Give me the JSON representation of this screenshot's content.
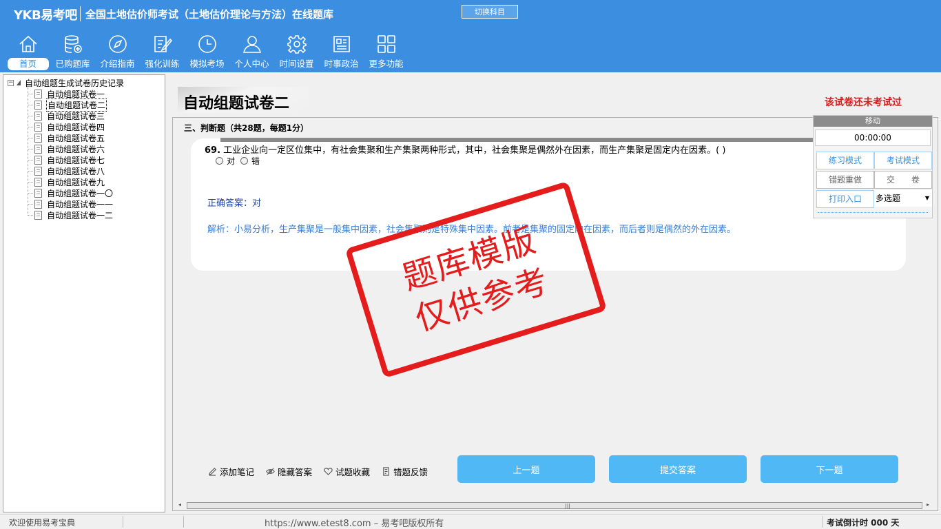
{
  "header": {
    "logo": "YKB易考吧",
    "title": "全国土地估价师考试（土地估价理论与方法）在线题库",
    "switch_subject": "切换科目",
    "nav": [
      {
        "label": "首页",
        "icon": "home-icon"
      },
      {
        "label": "已购题库",
        "icon": "database-icon"
      },
      {
        "label": "介绍指南",
        "icon": "compass-icon"
      },
      {
        "label": "强化训练",
        "icon": "edit-icon"
      },
      {
        "label": "模拟考场",
        "icon": "clock-icon"
      },
      {
        "label": "个人中心",
        "icon": "user-icon"
      },
      {
        "label": "时间设置",
        "icon": "gear-icon"
      },
      {
        "label": "时事政治",
        "icon": "news-icon"
      },
      {
        "label": "更多功能",
        "icon": "grid-icon"
      }
    ]
  },
  "tree": {
    "root_label": "自动组题生成试卷历史记录",
    "items": [
      "自动组题试卷一",
      "自动组题试卷二",
      "自动组题试卷三",
      "自动组题试卷四",
      "自动组题试卷五",
      "自动组题试卷六",
      "自动组题试卷七",
      "自动组题试卷八",
      "自动组题试卷九",
      "自动组题试卷一〇",
      "自动组题试卷一一",
      "自动组题试卷一二"
    ],
    "selected_index": 1
  },
  "main": {
    "paper_title": "自动组题试卷二",
    "paper_status": "该试卷还未考试过",
    "section_title": "三、判断题（共28题，每题1分）",
    "question": {
      "number": "69.",
      "text": "工业企业向一定区位集中，有社会集聚和生产集聚两种形式，其中，社会集聚是偶然外在因素，而生产集聚是固定内在因素。( )",
      "options": [
        "对",
        "错"
      ],
      "answer": "正确答案：对",
      "analysis": "解析：小易分析，生产集聚是一般集中因素，社会集聚则是特殊集中因素。前者是集聚的固定内在因素，而后者则是偶然的外在因素。"
    },
    "tools": [
      {
        "label": "添加笔记",
        "icon": "pencil-icon"
      },
      {
        "label": "隐藏答案",
        "icon": "eye-icon"
      },
      {
        "label": "试题收藏",
        "icon": "heart-icon"
      },
      {
        "label": "错题反馈",
        "icon": "feedback-icon"
      }
    ],
    "prev_label": "上一题",
    "submit_label": "提交答案",
    "next_label": "下一题"
  },
  "panel": {
    "move_label": "移动",
    "timer": "00:00:00",
    "practice_mode": "练习模式",
    "exam_mode": "考试模式",
    "redo_wrong": "错题重做",
    "hand_in": "交　　卷",
    "print": "打印入口",
    "question_type": "多选题"
  },
  "stamp": {
    "line1": "题库模版",
    "line2": "仅供参考"
  },
  "statusbar": {
    "welcome": "欢迎使用易考宝典",
    "copyright": "https://www.etest8.com – 易考吧版权所有",
    "countdown": "考试倒计时 000 天"
  }
}
